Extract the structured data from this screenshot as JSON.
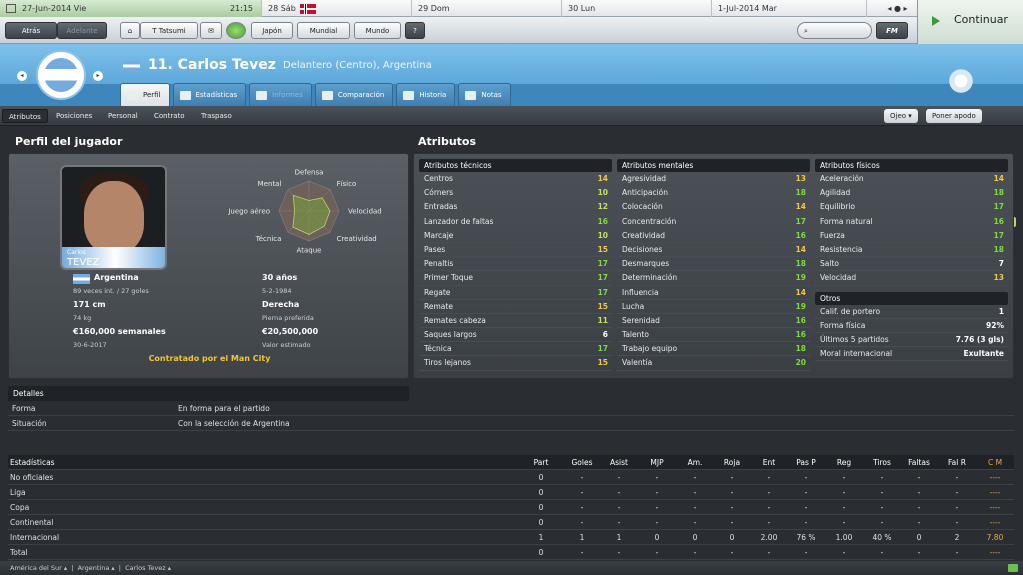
{
  "calendar": {
    "today_date": "27-Jun-2014 Vie",
    "time": "21:15",
    "days": [
      "28 Sáb",
      "29 Dom",
      "30 Lun",
      "1-Jul-2014 Mar"
    ]
  },
  "toolbar": {
    "back": "Atrás",
    "forward": "Adelante",
    "manager": "T Tatsumi",
    "nation": "Japón",
    "world_cup": "Mundial",
    "world": "Mundo",
    "help": "?",
    "search_placeholder": "",
    "fm": "FM",
    "continue": "Continuar"
  },
  "player": {
    "number_name": "11. Carlos Tevez",
    "position_nation": "Delantero (Centro), Argentina"
  },
  "tabs": [
    {
      "label": "Perfil",
      "active": true
    },
    {
      "label": "Estadísticas"
    },
    {
      "label": "Informes",
      "disabled": true
    },
    {
      "label": "Comparación"
    },
    {
      "label": "Historia"
    },
    {
      "label": "Notas"
    }
  ],
  "subtabs": [
    "Atributos",
    "Posiciones",
    "Personal",
    "Contrato",
    "Traspaso"
  ],
  "subtab_buttons": {
    "eye": "Ojeo",
    "nickname": "Poner apodo"
  },
  "sections": {
    "profile": "Perfil del jugador",
    "attributes": "Atributos",
    "details": "Detalles",
    "stats": "Estadísticas"
  },
  "photo": {
    "first": "Carlos",
    "last": "TEVEZ"
  },
  "radar": {
    "labels": [
      "Defensa",
      "Físico",
      "Velocidad",
      "Creatividad",
      "Ataque",
      "Técnica",
      "Juego aéreo",
      "Mental"
    ],
    "values": [
      0.35,
      0.62,
      0.7,
      0.72,
      0.78,
      0.76,
      0.48,
      0.74
    ]
  },
  "profile": {
    "nation": "Argentina",
    "caps": "89 veces int. / 27 goles",
    "age": "30 años",
    "dob": "5-2-1984",
    "height": "171 cm",
    "weight": "74 kg",
    "foot": "Derecha",
    "foot_label": "Pierna preferida",
    "wage": "€160,000 semanales",
    "contract_end": "30-6-2017",
    "value": "€20,500,000",
    "value_label": "Valor estimado",
    "contracted": "Contratado por el Man City"
  },
  "attributes": {
    "technical": {
      "title": "Atributos técnicos",
      "rows": [
        [
          "Centros",
          "14"
        ],
        [
          "Córners",
          "10"
        ],
        [
          "Entradas",
          "12"
        ],
        [
          "Lanzador de faltas",
          "16"
        ],
        [
          "Marcaje",
          "10"
        ],
        [
          "Pases",
          "15"
        ],
        [
          "Penaltis",
          "17"
        ],
        [
          "Primer Toque",
          "17"
        ],
        [
          "Regate",
          "17"
        ],
        [
          "Remate",
          "15"
        ],
        [
          "Remates cabeza",
          "11"
        ],
        [
          "Saques largos",
          "6"
        ],
        [
          "Técnica",
          "17"
        ],
        [
          "Tiros lejanos",
          "15"
        ]
      ]
    },
    "mental": {
      "title": "Atributos mentales",
      "rows": [
        [
          "Agresividad",
          "13"
        ],
        [
          "Anticipación",
          "18"
        ],
        [
          "Colocación",
          "14"
        ],
        [
          "Concentración",
          "17"
        ],
        [
          "Creatividad",
          "16"
        ],
        [
          "Decisiones",
          "14"
        ],
        [
          "Desmarques",
          "18"
        ],
        [
          "Determinación",
          "19"
        ],
        [
          "Influencia",
          "14"
        ],
        [
          "Lucha",
          "19"
        ],
        [
          "Serenidad",
          "16"
        ],
        [
          "Talento",
          "16"
        ],
        [
          "Trabajo equipo",
          "18"
        ],
        [
          "Valentía",
          "20"
        ]
      ]
    },
    "physical": {
      "title": "Atributos físicos",
      "rows": [
        [
          "Aceleración",
          "14"
        ],
        [
          "Agilidad",
          "18"
        ],
        [
          "Equilibrio",
          "17"
        ],
        [
          "Forma natural",
          "16"
        ],
        [
          "Fuerza",
          "17"
        ],
        [
          "Resistencia",
          "18"
        ],
        [
          "Salto",
          "7"
        ],
        [
          "Velocidad",
          "13"
        ]
      ]
    },
    "other": {
      "title": "Otros",
      "rows": [
        [
          "Calif. de portero",
          "1"
        ],
        [
          "Forma física",
          "92%"
        ],
        [
          "Últimos 5 partidos",
          "7.76 (3 gls)"
        ],
        [
          "Moral internacional",
          "Exultante"
        ]
      ]
    }
  },
  "details": [
    [
      "Forma",
      "En forma para el partido"
    ],
    [
      "Situación",
      "Con la selección de Argentina"
    ]
  ],
  "stats": {
    "headers": [
      "Part",
      "Goles",
      "Asist",
      "MJP",
      "Am.",
      "Roja",
      "Ent",
      "Pas P",
      "Reg",
      "Tiros",
      "Faltas",
      "Fal R",
      "C M"
    ],
    "rows": [
      [
        "No oficiales",
        "0",
        "-",
        "-",
        "-",
        "-",
        "-",
        "-",
        "-",
        "-",
        "-",
        "-",
        "-",
        "----"
      ],
      [
        "Liga",
        "0",
        "-",
        "-",
        "-",
        "-",
        "-",
        "-",
        "-",
        "-",
        "-",
        "-",
        "-",
        "----"
      ],
      [
        "Copa",
        "0",
        "-",
        "-",
        "-",
        "-",
        "-",
        "-",
        "-",
        "-",
        "-",
        "-",
        "-",
        "----"
      ],
      [
        "Continental",
        "0",
        "-",
        "-",
        "-",
        "-",
        "-",
        "-",
        "-",
        "-",
        "-",
        "-",
        "-",
        "----"
      ],
      [
        "Internacional",
        "1",
        "1",
        "1",
        "0",
        "0",
        "0",
        "2.00",
        "76 %",
        "1.00",
        "40 %",
        "0",
        "2",
        "7.80"
      ],
      [
        "Total",
        "0",
        "-",
        "-",
        "-",
        "-",
        "-",
        "-",
        "-",
        "-",
        "-",
        "-",
        "-",
        "----"
      ]
    ]
  },
  "footer": {
    "crumbs": [
      "América del Sur",
      "Argentina",
      "Carlos Tevez"
    ]
  }
}
